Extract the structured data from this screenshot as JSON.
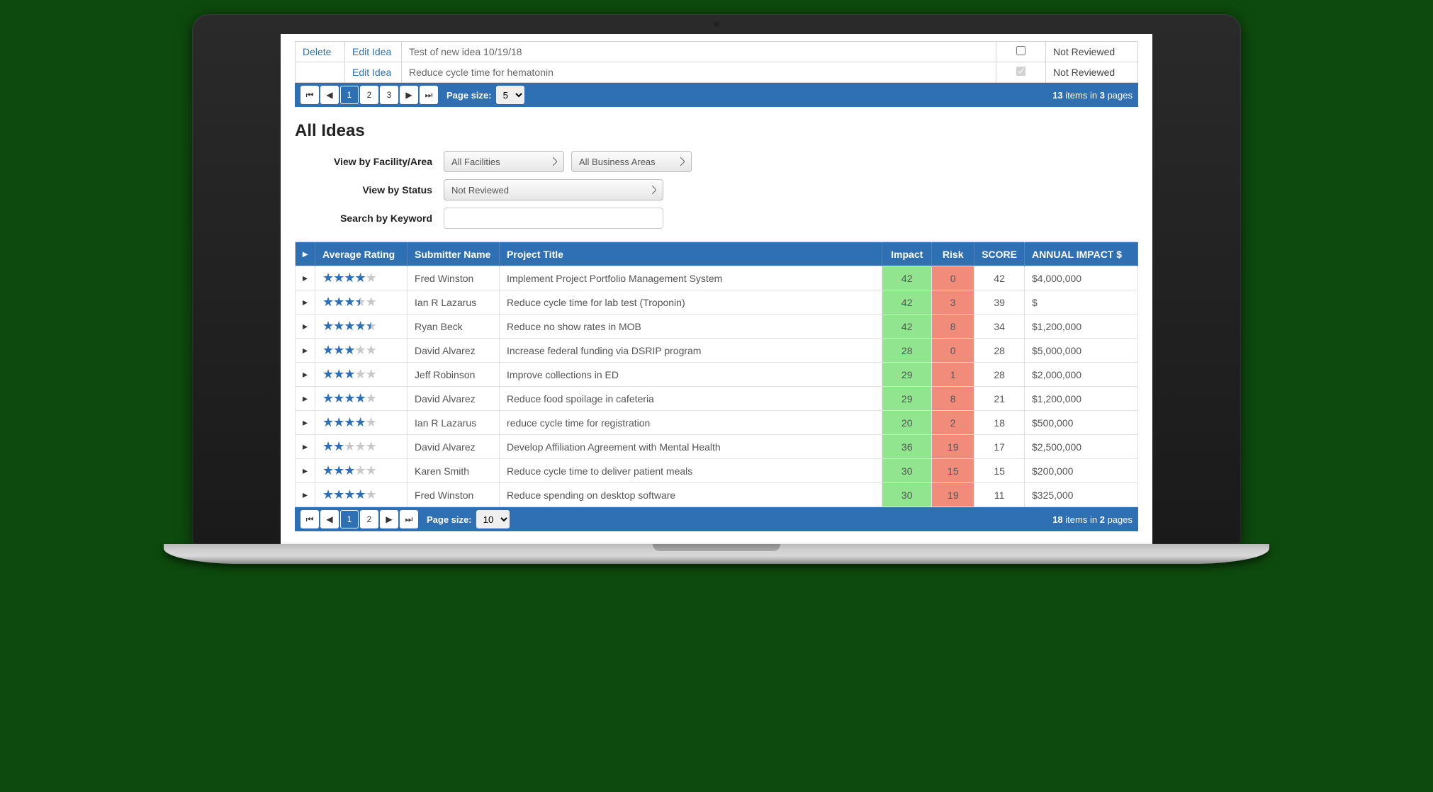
{
  "top_table": {
    "rows": [
      {
        "delete": "Delete",
        "edit": "Edit Idea",
        "title": "Test of new idea 10/19/18",
        "checked": false,
        "check_disabled": false,
        "status": "Not Reviewed"
      },
      {
        "delete": "",
        "edit": "Edit Idea",
        "title": "Reduce cycle time for hematonin",
        "checked": true,
        "check_disabled": true,
        "status": "Not Reviewed"
      }
    ]
  },
  "top_pager": {
    "pages": [
      "1",
      "2",
      "3"
    ],
    "active": "1",
    "page_size_label": "Page size:",
    "page_size": "5",
    "total_items": "13",
    "total_pages": "3",
    "items_word": "items in",
    "pages_word": "pages"
  },
  "section_title": "All Ideas",
  "filters": {
    "facility_label": "View by Facility/Area",
    "facility_value": "All Facilities",
    "area_value": "All Business Areas",
    "status_label": "View by Status",
    "status_value": "Not Reviewed",
    "search_label": "Search by Keyword"
  },
  "grid": {
    "headers": {
      "rating": "Average Rating",
      "submitter": "Submitter Name",
      "project": "Project Title",
      "impact": "Impact",
      "risk": "Risk",
      "score": "SCORE",
      "annual": "ANNUAL IMPACT $"
    },
    "rows": [
      {
        "rating": 4,
        "submitter": "Fred Winston",
        "title": "Implement Project Portfolio Management System",
        "impact": "42",
        "risk": "0",
        "score": "42",
        "annual": "$4,000,000"
      },
      {
        "rating": 3.5,
        "submitter": "Ian R Lazarus",
        "title": "Reduce cycle time for lab test (Troponin)",
        "impact": "42",
        "risk": "3",
        "score": "39",
        "annual": "$"
      },
      {
        "rating": 4.5,
        "submitter": "Ryan Beck",
        "title": "Reduce no show rates in MOB",
        "impact": "42",
        "risk": "8",
        "score": "34",
        "annual": "$1,200,000"
      },
      {
        "rating": 3,
        "submitter": "David Alvarez",
        "title": "Increase federal funding via DSRIP program",
        "impact": "28",
        "risk": "0",
        "score": "28",
        "annual": "$5,000,000"
      },
      {
        "rating": 3,
        "submitter": "Jeff Robinson",
        "title": "Improve collections in ED",
        "impact": "29",
        "risk": "1",
        "score": "28",
        "annual": "$2,000,000"
      },
      {
        "rating": 4,
        "submitter": "David Alvarez",
        "title": "Reduce food spoilage in cafeteria",
        "impact": "29",
        "risk": "8",
        "score": "21",
        "annual": "$1,200,000"
      },
      {
        "rating": 4,
        "submitter": "Ian R Lazarus",
        "title": "reduce cycle time for registration",
        "impact": "20",
        "risk": "2",
        "score": "18",
        "annual": "$500,000"
      },
      {
        "rating": 2,
        "submitter": "David Alvarez",
        "title": "Develop Affiliation Agreement with Mental Health",
        "impact": "36",
        "risk": "19",
        "score": "17",
        "annual": "$2,500,000"
      },
      {
        "rating": 3,
        "submitter": "Karen Smith",
        "title": "Reduce cycle time to deliver patient meals",
        "impact": "30",
        "risk": "15",
        "score": "15",
        "annual": "$200,000"
      },
      {
        "rating": 4,
        "submitter": "Fred Winston",
        "title": "Reduce spending on desktop software",
        "impact": "30",
        "risk": "19",
        "score": "11",
        "annual": "$325,000"
      }
    ]
  },
  "bottom_pager": {
    "pages": [
      "1",
      "2"
    ],
    "active": "1",
    "page_size_label": "Page size:",
    "page_size": "10",
    "total_items": "18",
    "total_pages": "2",
    "items_word": "items in",
    "pages_word": "pages"
  }
}
